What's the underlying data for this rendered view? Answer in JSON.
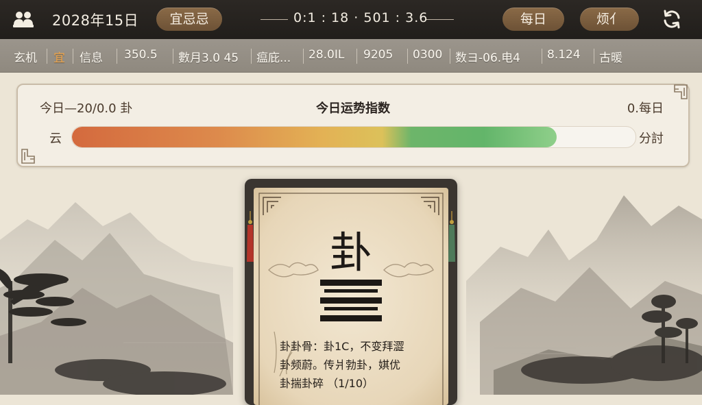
{
  "topbar": {
    "date": "2028年15日",
    "yiji_label": "宜忌忌",
    "clock": "0:1  :  18  ·  501  :  3.6",
    "daily_label": "每日",
    "tarot_label": "烦亻",
    "icons": [
      "users-icon",
      "refresh-icon"
    ]
  },
  "infostrip": {
    "items": [
      {
        "text": "玄机",
        "accent": false
      },
      {
        "text": "宜",
        "accent": true
      },
      {
        "text": "信息",
        "accent": false
      },
      {
        "text": "350.5",
        "accent": false
      },
      {
        "text": "數月3.0 45",
        "accent": false
      },
      {
        "text": "瘟庇...",
        "accent": false
      },
      {
        "text": "28.0IL",
        "accent": false
      },
      {
        "text": "9205",
        "accent": false
      },
      {
        "text": "0300",
        "accent": false
      },
      {
        "text": "数ヨ-06.电4",
        "accent": false
      },
      {
        "text": "8.124",
        "accent": false
      },
      {
        "text": "古暖",
        "accent": false
      }
    ]
  },
  "fortune": {
    "left_label": "今日—20/0.0 卦",
    "title": "今日运势指数",
    "right_label": "0.每日",
    "bar_left": "云",
    "bar_right": "分討",
    "progress": 0.86
  },
  "card": {
    "symbol": "卦",
    "lines": [
      "卦卦骨：卦1C，不变拜澀",
      "卦频蔚。传爿勃卦，娸优",
      "卦揣卦碎 （1/10）"
    ]
  },
  "colors": {
    "topbar": "#24211e",
    "pill": "#7b5d3e",
    "accent_orange": "#f0a64a",
    "panel_bg": "#f3eee4",
    "card_frame": "#3a3530"
  }
}
